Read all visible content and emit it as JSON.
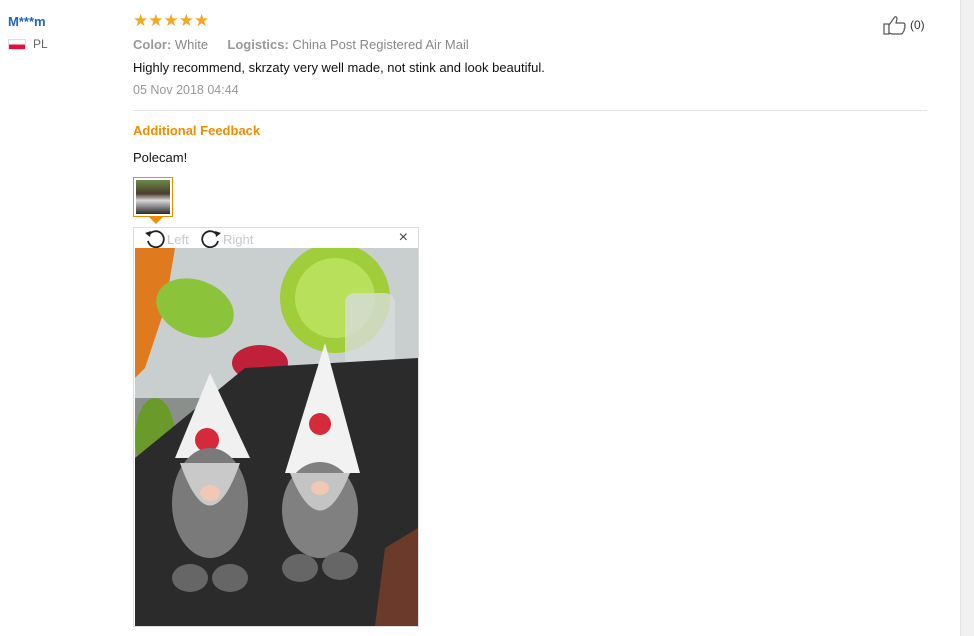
{
  "user": {
    "name": "M***m",
    "country": "PL"
  },
  "review": {
    "stars": "★★★★★",
    "rating": 5,
    "color_label": "Color:",
    "color_value": "White",
    "logistics_label": "Logistics:",
    "logistics_value": "China Post Registered Air Mail",
    "text": "Highly recommend, skrzaty very well made, not stink and look beautiful.",
    "date": "05 Nov 2018 04:44",
    "helpful_count": "(0)"
  },
  "additional": {
    "heading": "Additional Feedback",
    "text": "Polecam!"
  },
  "viewer": {
    "rotate_left_label": "Left",
    "rotate_right_label": "Right",
    "close_label": "×"
  },
  "colors": {
    "accent": "#f08c00",
    "username": "#1a66c4",
    "star": "#f5a623"
  }
}
